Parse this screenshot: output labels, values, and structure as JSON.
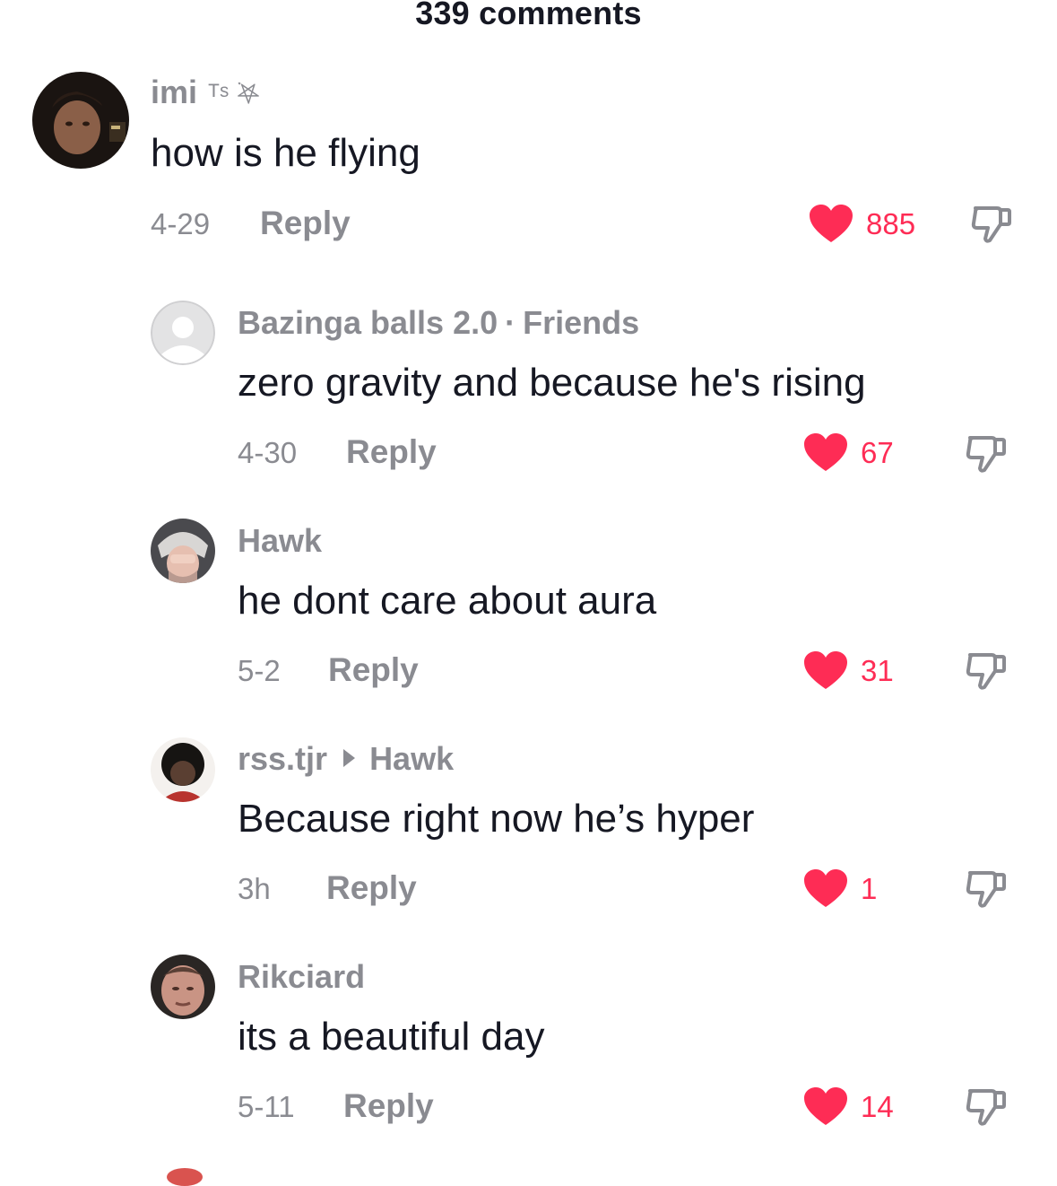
{
  "header": {
    "title": "339 comments"
  },
  "colors": {
    "like_active": "#fe2c55",
    "secondary_text": "#8a8b91",
    "primary_text": "#161823"
  },
  "comments": [
    {
      "username": "imi",
      "username_badge": "ᵀˢ ࣪𖤐",
      "text": "how is he flying",
      "date": "4-29",
      "reply_label": "Reply",
      "likes": "885",
      "liked": true,
      "avatar": "avatar-photo"
    },
    {
      "username": "Bazinga balls 2.0",
      "separator": "·",
      "relation": "Friends",
      "text": "zero gravity and because he's rising",
      "date": "4-30",
      "reply_label": "Reply",
      "likes": "67",
      "liked": true,
      "avatar": "default-avatar-icon"
    },
    {
      "username": "Hawk",
      "text": "he dont care about aura",
      "date": "5-2",
      "reply_label": "Reply",
      "likes": "31",
      "liked": true,
      "avatar": "avatar-photo"
    },
    {
      "username": "rss.tjr",
      "reply_to": "Hawk",
      "text": "Because right now he’s hyper",
      "date": "3h",
      "reply_label": "Reply",
      "likes": "1",
      "liked": true,
      "avatar": "avatar-photo"
    },
    {
      "username": "Rikciard",
      "text": "its a beautiful day",
      "date": "5-11",
      "reply_label": "Reply",
      "likes": "14",
      "liked": true,
      "avatar": "avatar-photo"
    }
  ]
}
